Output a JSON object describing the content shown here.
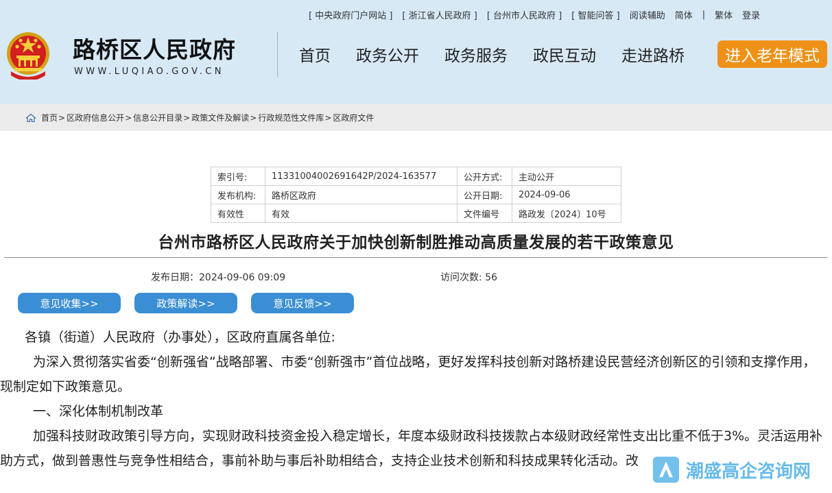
{
  "header": {
    "top_links": [
      "[ 中央政府门户网站 ]",
      "[ 浙江省人民政府 ]",
      "[ 台州市人民政府 ]",
      "[ 智能问答 ]",
      "阅读辅助",
      "简体",
      "|",
      "繁体",
      "登录"
    ],
    "site_title": "路桥区人民政府",
    "site_url": "WWW.LUQIAO.GOV.CN",
    "nav": [
      "首页",
      "政务公开",
      "政务服务",
      "政民互动",
      "走进路桥"
    ],
    "elder_mode_label": "进入老年模式",
    "emblem_icon": "national-emblem-icon"
  },
  "breadcrumb": [
    "首页",
    "区政府信息公开",
    "信息公开目录",
    "政策文件及解读",
    "行政规范性文件库",
    "区政府文件"
  ],
  "meta": {
    "rows": [
      {
        "k1": "索引号:",
        "v1": "11331004002691642P/2024-163577",
        "k2": "公开方式:",
        "v2": "主动公开"
      },
      {
        "k1": "发布机构:",
        "v1": "路桥区政府",
        "k2": "公开日期:",
        "v2": "2024-09-06"
      },
      {
        "k1": "有效性",
        "v1": "有效",
        "k2": "文件编号",
        "v2": "路政发〔2024〕10号"
      }
    ]
  },
  "doc": {
    "title": "台州市路桥区人民政府关于加快创新制胜推动高质量发展的若干政策意见",
    "pub_date": "发布日期：2024-09-06 09:09",
    "visits": "访问次数: 56",
    "buttons": [
      "意见收集>>",
      "政策解读>>",
      "意见反馈>>"
    ],
    "salutation": "各镇（街道）人民政府（办事处），区政府直属各单位:",
    "para1": "为深入贯彻落实省委“创新强省”战略部署、市委“创新强市”首位战略，更好发挥科技创新对路桥建设民营经济创新区的引领和支撑作用，现制定如下政策意见。",
    "section1": "一、深化体制机制改革",
    "para2": "加强科技财政政策引导方向，实现财政科技资金投入稳定增长，年度本级财政科技拨款占本级财政经常性支出比重不低于3%。灵活运用补助方式，做到普惠性与竞争性相结合，事前补助与事后补助相结合，支持企业技术创新和科技成果转化活动。改"
  },
  "watermark": {
    "text": "潮盛高企咨询网",
    "logo_icon": "watermark-logo-icon",
    "color": "#5ab5ea"
  },
  "colors": {
    "header_bg": "#d8e9f6",
    "accent_orange": "#ef9117",
    "button_blue": "#3a8ed3",
    "breadcrumb_bg": "#ebebeb"
  }
}
